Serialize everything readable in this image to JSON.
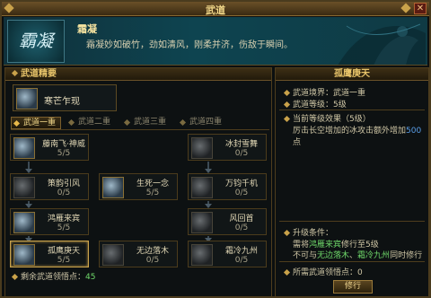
{
  "window": {
    "title": "武道"
  },
  "banner": {
    "logo_text": "霸凝",
    "name": "霜凝",
    "desc": "霜凝妙如破竹，劲如清风，刚柔并济，伤敌于瞬间。"
  },
  "left_panel": {
    "header": "武道精要",
    "top_skill": {
      "name": "寒芒乍现"
    },
    "tabs": [
      "武道一重",
      "武道二重",
      "武道三重",
      "武道四重"
    ],
    "active_tab": 0,
    "nodes": [
      {
        "name": "藤南飞·神威",
        "level": "5/5"
      },
      {
        "name": "冰封雪舞",
        "level": "0/5"
      },
      {
        "name": "策韵引风",
        "level": "0/5"
      },
      {
        "name": "生死一念",
        "level": "5/5"
      },
      {
        "name": "万钧千机",
        "level": "0/5"
      },
      {
        "name": "鸿雁来宾",
        "level": "5/5"
      },
      {
        "name": "风回首",
        "level": "0/5"
      },
      {
        "name": "孤鹰庚天",
        "level": "5/5"
      },
      {
        "name": "无边落木",
        "level": "0/5"
      },
      {
        "name": "霜冷九州",
        "level": "0/5"
      }
    ],
    "remain_label": "剩余武道领悟点：",
    "remain_value": "45"
  },
  "right_panel": {
    "header": "孤鹰庚天",
    "realm_label": "武道境界：",
    "realm_value": "武道一重",
    "level_label": "武道等级：",
    "level_value": "5级",
    "effect_label": "当前等级效果（5级）",
    "effect_pre": "厉击长空增加的冰攻击额外增加",
    "effect_value": "500",
    "effect_suffix": "点",
    "cond_label": "升级条件：",
    "cond1_pre": "需将",
    "cond1_hl": "鸿雁来宾",
    "cond1_post": "修行至5级",
    "cond2_pre": "不可与",
    "cond2_hl1": "无边落木",
    "cond2_sep": "、",
    "cond2_hl2": "霜冷九州",
    "cond2_post": "同时修行",
    "need_label": "所需武道领悟点：",
    "need_value": "0",
    "button": "修行"
  },
  "colors": {
    "accent_gold": "#c9a24a",
    "highlight_blue": "#5a9ee8",
    "highlight_green": "#6fd86a",
    "highlight_red": "#e85a4a"
  }
}
